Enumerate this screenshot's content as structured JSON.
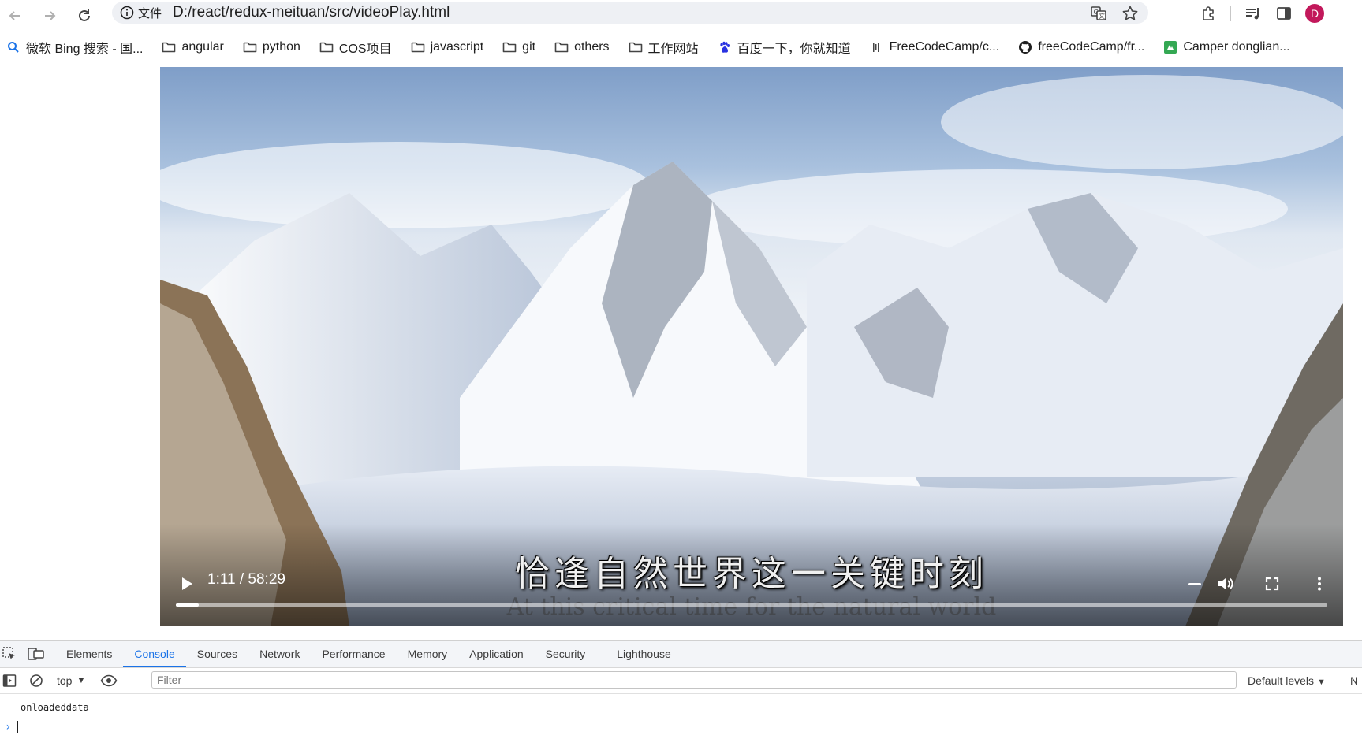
{
  "toolbar": {
    "site_info_label": "文件",
    "url": "D:/react/redux-meituan/src/videoPlay.html",
    "avatar_letter": "D"
  },
  "bookmarks": [
    {
      "label": "微软 Bing 搜索 - 国...",
      "icon": "search-icon"
    },
    {
      "label": "angular",
      "icon": "folder-icon"
    },
    {
      "label": "python",
      "icon": "folder-icon"
    },
    {
      "label": "COS项目",
      "icon": "folder-icon"
    },
    {
      "label": "javascript",
      "icon": "folder-icon"
    },
    {
      "label": "git",
      "icon": "folder-icon"
    },
    {
      "label": "others",
      "icon": "folder-icon"
    },
    {
      "label": "工作网站",
      "icon": "folder-icon"
    },
    {
      "label": "百度一下，你就知道",
      "icon": "baidu-icon"
    },
    {
      "label": "FreeCodeCamp/c...",
      "icon": "freecodecamp-icon"
    },
    {
      "label": "freeCodeCamp/fr...",
      "icon": "github-icon"
    },
    {
      "label": "Camper donglian...",
      "icon": "camper-icon"
    }
  ],
  "video": {
    "subtitle_zh": "恰逢自然世界这一关键时刻",
    "subtitle_en": "At this critical time for the natural world",
    "time_display": "1:11 / 58:29",
    "progress_fraction": 0.0202
  },
  "devtools": {
    "tabs": [
      {
        "label": "Elements",
        "active": false
      },
      {
        "label": "Console",
        "active": true
      },
      {
        "label": "Sources",
        "active": false
      },
      {
        "label": "Network",
        "active": false
      },
      {
        "label": "Performance",
        "active": false
      },
      {
        "label": "Memory",
        "active": false
      },
      {
        "label": "Application",
        "active": false
      },
      {
        "label": "Security",
        "active": false
      },
      {
        "label": "Lighthouse",
        "active": false
      }
    ],
    "context": "top",
    "filter_placeholder": "Filter",
    "levels": "Default levels",
    "levels_truncated": "N",
    "log": "onloadeddata",
    "accent": "#1a73e8"
  }
}
